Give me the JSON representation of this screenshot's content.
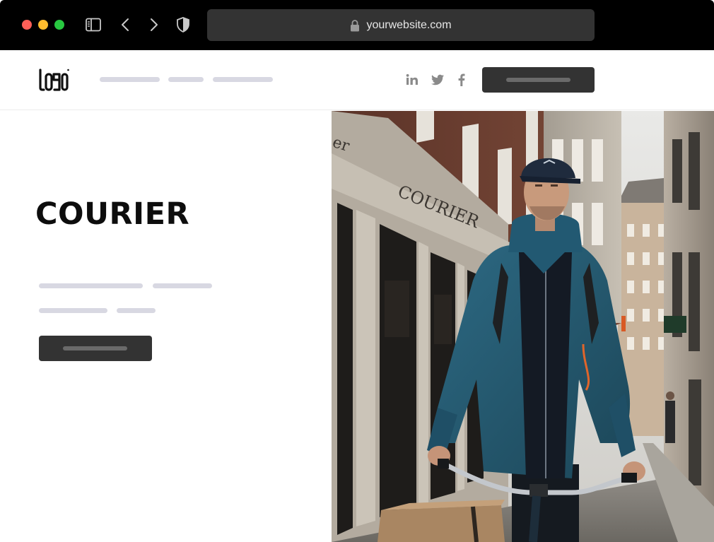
{
  "browser": {
    "url": "yourwebsite.com",
    "icons": [
      "sidebar-toggle-icon",
      "back-arrow-icon",
      "forward-arrow-icon",
      "shield-icon",
      "lock-icon"
    ]
  },
  "header": {
    "logo_text": "LOGO",
    "social_icons": [
      "linkedin-icon",
      "twitter-icon",
      "facebook-icon"
    ]
  },
  "hero": {
    "title": "COURIER",
    "photo_sign": "COURIER"
  },
  "colors": {
    "chrome_bg": "#000000",
    "address_bar": "#333333",
    "placeholder_line": "#d8d8e2",
    "button_bg": "#333333",
    "title_text": "#0d0d0d"
  }
}
